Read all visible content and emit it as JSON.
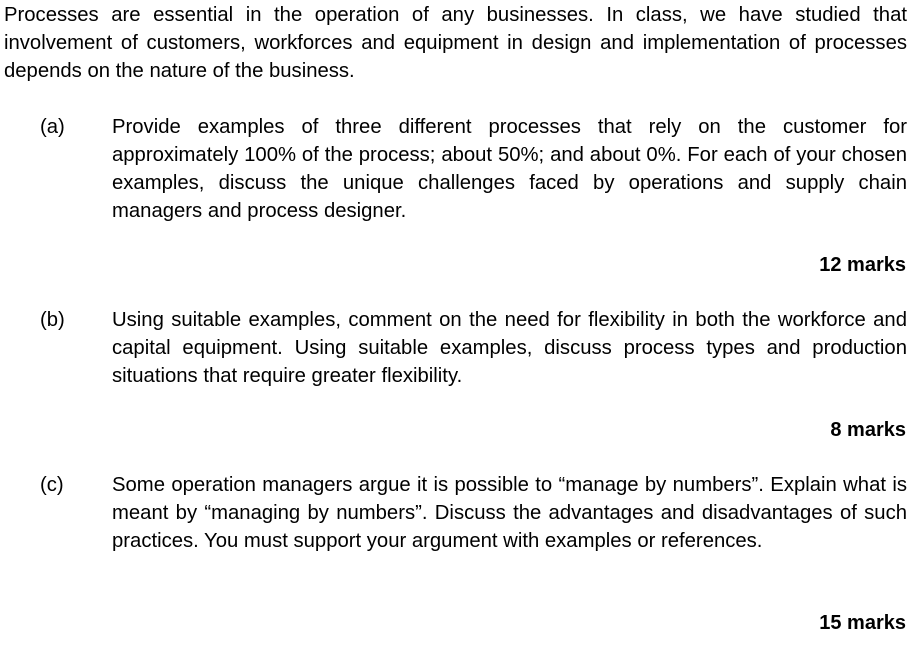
{
  "intro": "Processes are essential in the operation of any businesses. In class, we have studied that involvement of customers, workforces and equipment in design and implementation of processes depends on the nature of the business.",
  "questions": [
    {
      "label": "(a)",
      "text": "Provide examples of three different processes that rely on the customer for approximately 100% of the process; about 50%; and about 0%. For each of your chosen examples, discuss the unique challenges faced by operations and supply chain managers and process designer.",
      "marks": "12 marks"
    },
    {
      "label": "(b)",
      "text": "Using suitable examples, comment on the need for flexibility in both the workforce and capital equipment. Using suitable examples, discuss process types and production situations that require greater flexibility.",
      "marks": "8 marks"
    },
    {
      "label": "(c)",
      "text": "Some operation managers argue it is possible to “manage by numbers”. Explain what is meant by “managing by numbers”. Discuss the advantages and disadvantages of such practices. You must support your argument with examples or references.",
      "marks": "15 marks"
    }
  ]
}
